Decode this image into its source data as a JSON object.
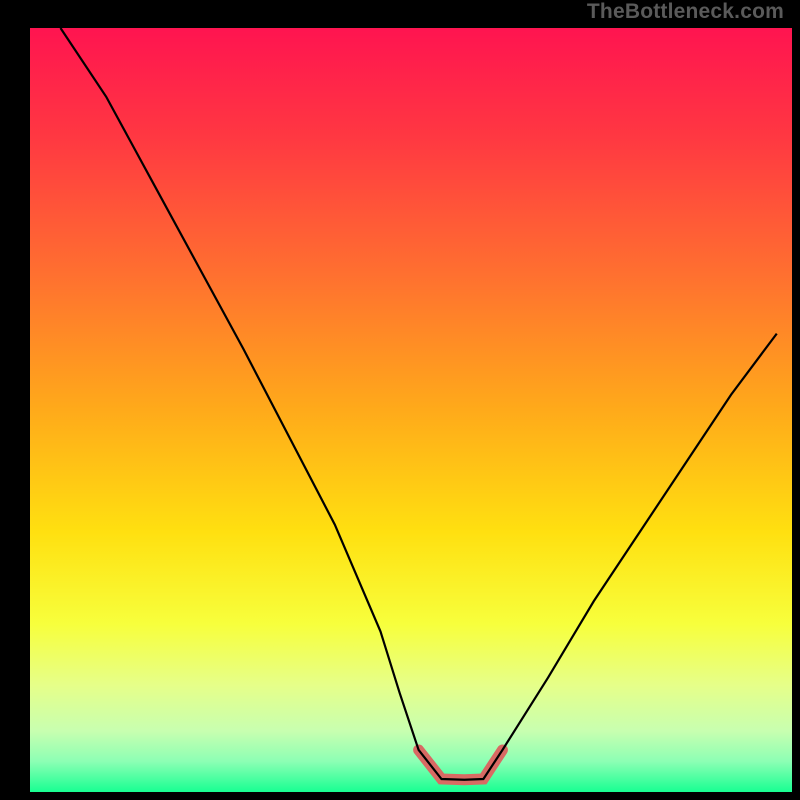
{
  "watermark": "TheBottleneck.com",
  "colors": {
    "background": "#000000",
    "watermark": "#5a5a5a",
    "curve": "#000000",
    "accent": "#d86a63",
    "gradient_stops": [
      {
        "offset": 0.0,
        "color": "#ff1450"
      },
      {
        "offset": 0.14,
        "color": "#ff3742"
      },
      {
        "offset": 0.32,
        "color": "#ff6f30"
      },
      {
        "offset": 0.5,
        "color": "#ffaa1a"
      },
      {
        "offset": 0.66,
        "color": "#ffe010"
      },
      {
        "offset": 0.78,
        "color": "#f7ff3c"
      },
      {
        "offset": 0.86,
        "color": "#e6ff89"
      },
      {
        "offset": 0.92,
        "color": "#c8ffb0"
      },
      {
        "offset": 0.96,
        "color": "#8cffb4"
      },
      {
        "offset": 1.0,
        "color": "#18ff92"
      }
    ]
  },
  "chart_data": {
    "type": "line",
    "title": "",
    "xlabel": "",
    "ylabel": "",
    "xlim": [
      0,
      100
    ],
    "ylim": [
      0,
      100
    ],
    "x": [
      4,
      10,
      16,
      22,
      28,
      34,
      40,
      46,
      48.5,
      51,
      54,
      57,
      59.5,
      62,
      68,
      74,
      80,
      86,
      92,
      98
    ],
    "values": [
      100,
      91,
      80,
      69,
      58,
      46.5,
      35,
      21,
      13,
      5.5,
      1.7,
      1.6,
      1.7,
      5.5,
      15,
      25,
      34,
      43,
      52,
      60
    ],
    "accent_region": {
      "x_start": 51,
      "x_end": 62,
      "y": 2.0
    },
    "notes": "V-shaped bottleneck curve. x is normalized 0-100 across the plot width (left border to right border of the colored area). values represent height from the bottom of the gradient area as a percentage (0 = bottom green edge, 100 = top red edge). The flat minimum near y≈1.6–1.7 is highlighted with a thick salmon stroke (accent_region)."
  }
}
